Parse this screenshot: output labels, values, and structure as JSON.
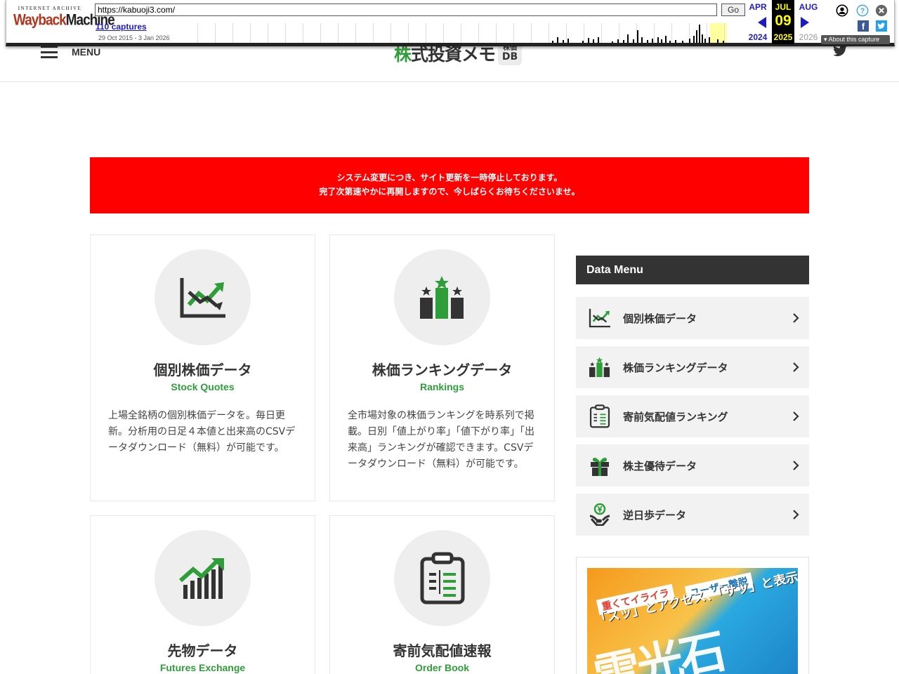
{
  "wayback": {
    "url": "https://kabuoji3.com/",
    "go_label": "Go",
    "captures": "110 captures",
    "range": "29 Oct 2015 - 3 Jan 2026",
    "logo_top": "INTERNET ARCHIVE",
    "logo_main_a": "Wayback",
    "logo_main_b": "Machine",
    "prev_month": "APR",
    "prev_year": "2024",
    "cur_month": "JUL",
    "cur_day": "09",
    "cur_year": "2025",
    "next_month": "AUG",
    "next_year": "2026",
    "about": "About this capture"
  },
  "header": {
    "menu_label": "MENU",
    "logo_accent": "株",
    "logo_rest": "式投資メモ",
    "logo_badge_top": "株価",
    "logo_badge_bottom": "DB"
  },
  "notice": {
    "line1": "システム変更につき、サイト更新を一時停止しております。",
    "line2": "完了次第速やかに再開しますので、今しばらくお待ちくださいませ。"
  },
  "cards": [
    {
      "title": "個別株価データ",
      "subtitle": "Stock Quotes",
      "desc": "上場全銘柄の個別株価データを。毎日更新。分析用の日足４本値と出来高のCSVデータダウンロード（無料）が可能です。"
    },
    {
      "title": "株価ランキングデータ",
      "subtitle": "Rankings",
      "desc": "全市場対象の株価ランキングを時系列で掲載。日別「値上がり率」「値下がり率」「出来高」ランキングが確認できます。CSVデータダウンロード（無料）が可能です。"
    },
    {
      "title": "先物データ",
      "subtitle": "Futures Exchange"
    },
    {
      "title": "寄前気配値速報",
      "subtitle": "Order Book"
    }
  ],
  "sidebar": {
    "heading": "Data Menu",
    "items": [
      {
        "label": "個別株価データ"
      },
      {
        "label": "株価ランキングデータ"
      },
      {
        "label": "寄前気配値ランキング"
      },
      {
        "label": "株主優待データ"
      },
      {
        "label": "逆日歩データ"
      }
    ]
  },
  "ad": {
    "tag1": "重くてイライラ",
    "tag2": "ユーザー離脱",
    "line": "「スッ」とアクセス、「サッ」と表示！",
    "big": "雷光石"
  }
}
